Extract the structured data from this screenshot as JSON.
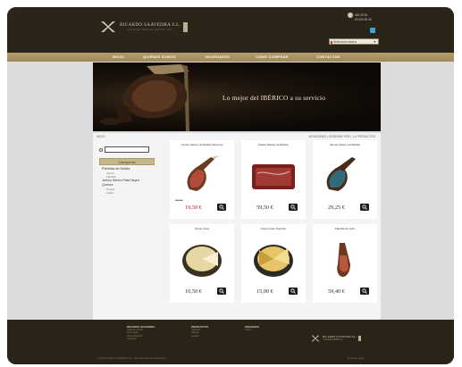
{
  "brand": {
    "name": "RICARDO SAAVEDRA S.L.",
    "tagline": "CALIDAD IBÉRICA DESDE 1961"
  },
  "contact": {
    "line1": "000 00 00",
    "line2": "00 000 00 00"
  },
  "language": {
    "selected": "Seleccione idioma"
  },
  "nav": {
    "items": [
      "INICIO",
      "QUIÉNES SOMOS",
      "NOVEDADES",
      "CÓMO COMPRAR",
      "CONTACTAR"
    ]
  },
  "banner": {
    "text": "Lo mejor del IBÉRICO a su servicio"
  },
  "breadcrumb": {
    "home": "INICIO",
    "right": "NOVEDADES | ORDENAR POR | 1-6 PRODUCTOS"
  },
  "search": {
    "placeholder": ""
  },
  "sidebar": {
    "header": "Categorías",
    "items": [
      {
        "label": "Paletillas de Bellota",
        "subs": [
          "Jamón",
          "Paletilla"
        ]
      },
      {
        "label": "Jamón Ibérico Pata Negra",
        "subs": []
      },
      {
        "label": "Quesos",
        "subs": [
          "Ovejas",
          "Cabra"
        ]
      }
    ]
  },
  "products": [
    {
      "name": "Jamón Ibérico de Bellota Reserva",
      "old": "20,00 €",
      "price": "19,50 €",
      "sale": true
    },
    {
      "name": "Paleta Ibérica de Bellota",
      "old": "",
      "price": "59,50 €",
      "sale": false
    },
    {
      "name": "Jamón Ibérico de Bellota",
      "old": "",
      "price": "29,25 €",
      "sale": false
    },
    {
      "name": "Queso viejo",
      "old": "",
      "price": "10,50 €",
      "sale": false
    },
    {
      "name": "Queso viejo Superior",
      "old": "",
      "price": "15,00 €",
      "sale": false
    },
    {
      "name": "Paletilla de cebo",
      "old": "",
      "price": "59,40 €",
      "sale": false
    }
  ],
  "footer": {
    "col1_title": "RICARDO SAAVEDRA",
    "col1_lines": [
      "Quiénes somos",
      "Aviso legal",
      "Cómo comprar",
      "Contacto"
    ],
    "col2_title": "PRODUCTOS",
    "col2_lines": [
      "Jamones",
      "Paletas",
      "Quesos"
    ],
    "col3_title": "SÍGUENOS",
    "col3_lines": [
      "Twitter"
    ],
    "logo_name": "RICARDO SAAVEDRA S.L.",
    "logo_tagline": "CALIDAD IBÉRICA",
    "copyright": "© 2013 RICARDO SAAVEDRA S.L. Todos los derechos reservados",
    "payments": "Formas de pago"
  },
  "colors": {
    "dark": "#2a2419",
    "nav": "#a8915f",
    "sale": "#c2262e",
    "button": "#1b1c1e"
  }
}
